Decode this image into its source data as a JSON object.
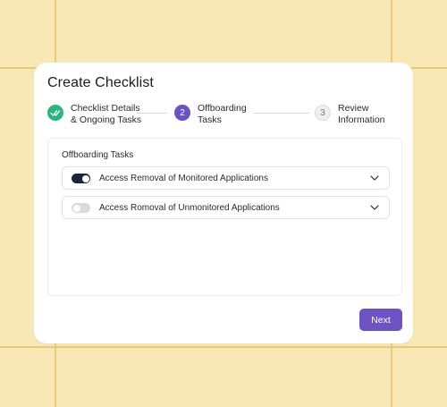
{
  "dialog": {
    "title": "Create Checklist",
    "next_label": "Next"
  },
  "steps": [
    {
      "number": "",
      "label_line1": "Checklist Details",
      "label_line2": "& Ongoing Tasks",
      "state": "completed"
    },
    {
      "number": "2",
      "label_line1": "Offboarding",
      "label_line2": "Tasks",
      "state": "active"
    },
    {
      "number": "3",
      "label_line1": "Review",
      "label_line2": "Information",
      "state": "upcoming"
    }
  ],
  "panel": {
    "title": "Offboarding Tasks",
    "tasks": [
      {
        "label": "Access Removal of Monitored Applications",
        "enabled": true,
        "icon": "chevron-down-icon"
      },
      {
        "label": "Access Romoval of Unmonitored Applications",
        "enabled": false,
        "icon": "chevron-down-icon"
      }
    ]
  },
  "colors": {
    "background": "#F8E8B5",
    "accent": "#6D52C4",
    "success": "#2CB67D",
    "toggle_on": "#1C2638"
  }
}
